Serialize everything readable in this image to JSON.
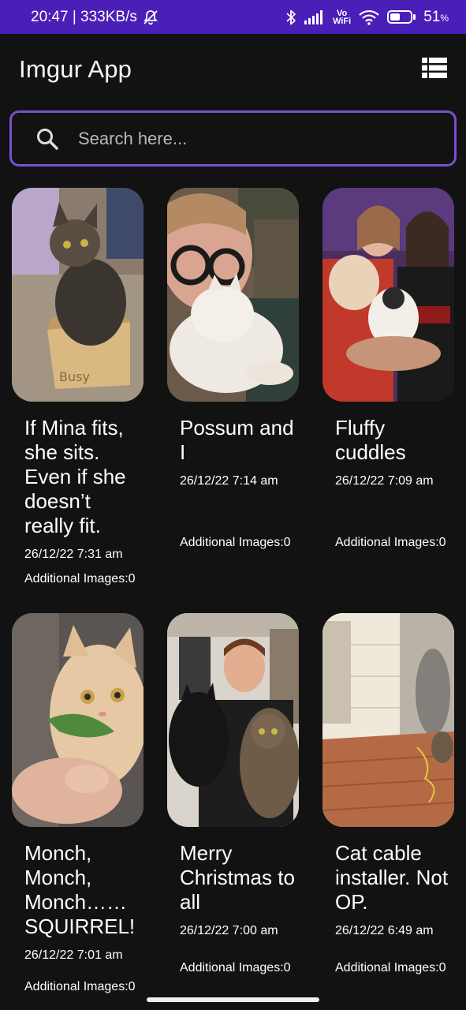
{
  "status_bar": {
    "time_speed": "20:47 | 333KB/s",
    "battery_percent": 51,
    "battery_label": "51",
    "battery_unit": "%",
    "vowifi_label_top": "Vo",
    "vowifi_label_bottom": "WiFi",
    "icons": [
      "mute-bell-icon",
      "bluetooth-icon",
      "signal-icon",
      "vowifi-icon",
      "wifi-icon",
      "battery-icon"
    ]
  },
  "app_bar": {
    "title": "Imgur App",
    "view_toggle_icon": "list-view-icon"
  },
  "search": {
    "placeholder": "Search here...",
    "value": "",
    "accent": "#7a4fd0"
  },
  "posts": [
    {
      "title": "If Mina fits, she sits. Even if she doesn’t really fit.",
      "date": "26/12/22 7:31 am",
      "additional": "Additional Images:0",
      "image": "tabby cat sitting in small cardboard box"
    },
    {
      "title": "Possum and I",
      "date": "26/12/22 7:14 am",
      "additional": "Additional Images:0",
      "image": "woman with glasses cuddling white cat"
    },
    {
      "title": "Fluffy cuddles",
      "date": "26/12/22 7:09 am",
      "additional": "Additional Images:0",
      "image": "couple holding two fluffy cats"
    },
    {
      "title": "Monch, Monch, Monch…… SQUIRREL!",
      "date": "26/12/22 7:01 am",
      "additional": "Additional Images:0",
      "image": "orange cat chewing green leaf"
    },
    {
      "title": "Merry Christmas to all",
      "date": "26/12/22 7:00 am",
      "additional": "Additional Images:0",
      "image": "man holding black cat and tabby cat"
    },
    {
      "title": "Cat cable installer. Not OP.",
      "date": "26/12/22 6:49 am",
      "additional": "Additional Images:0",
      "image": "wooden deck with cat and cable"
    }
  ],
  "colors": {
    "status_bar": "#4a1fb8",
    "background": "#121212"
  }
}
